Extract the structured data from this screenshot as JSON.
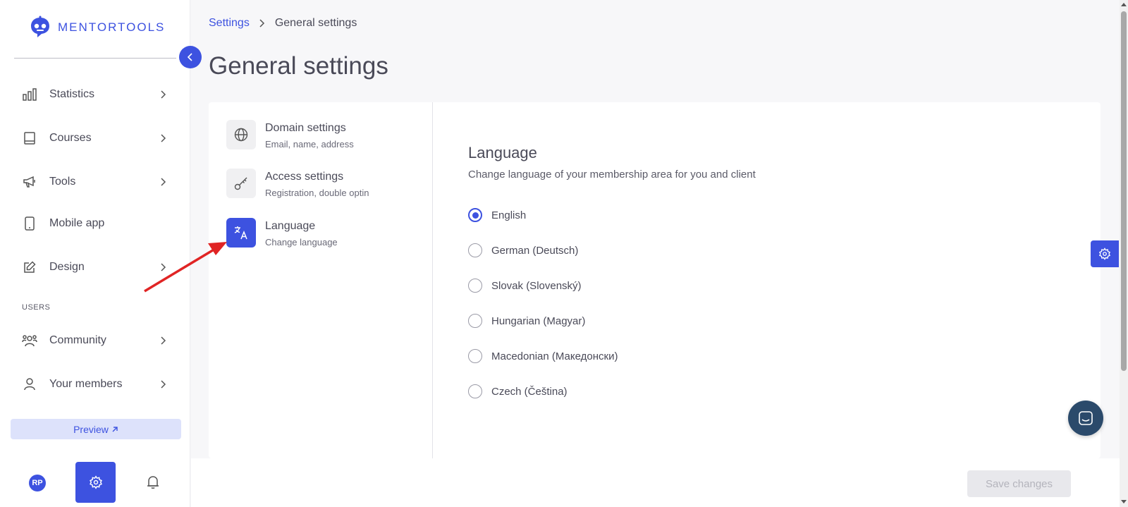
{
  "brand": {
    "name": "MENTORTOOLS",
    "accent": "#3d52e0"
  },
  "sidebar": {
    "items": [
      {
        "label": "Statistics",
        "icon": "bar-chart-icon",
        "has_chevron": true
      },
      {
        "label": "Courses",
        "icon": "book-icon",
        "has_chevron": true
      },
      {
        "label": "Tools",
        "icon": "megaphone-icon",
        "has_chevron": true
      },
      {
        "label": "Mobile app",
        "icon": "phone-icon",
        "has_chevron": false
      },
      {
        "label": "Design",
        "icon": "pencil-icon",
        "has_chevron": true
      },
      {
        "label": "Community",
        "icon": "users-icon",
        "has_chevron": true
      },
      {
        "label": "Your members",
        "icon": "user-icon",
        "has_chevron": true
      }
    ],
    "section_users": "USERS",
    "preview_label": "Preview",
    "avatar_initials": "RP"
  },
  "breadcrumb": {
    "parent": "Settings",
    "current": "General settings"
  },
  "page_title": "General settings",
  "settings_menu": [
    {
      "title": "Domain settings",
      "subtitle": "Email, name, address",
      "icon": "globe-icon",
      "active": false
    },
    {
      "title": "Access settings",
      "subtitle": "Registration, double optin",
      "icon": "key-icon",
      "active": false
    },
    {
      "title": "Language",
      "subtitle": "Change language",
      "icon": "translate-icon",
      "active": true
    }
  ],
  "language_section": {
    "title": "Language",
    "description": "Change language of your membership area for you and client",
    "options": [
      {
        "label": "English",
        "checked": true
      },
      {
        "label": "German (Deutsch)",
        "checked": false
      },
      {
        "label": "Slovak (Slovenský)",
        "checked": false
      },
      {
        "label": "Hungarian (Magyar)",
        "checked": false
      },
      {
        "label": "Macedonian (Македонски)",
        "checked": false
      },
      {
        "label": "Czech (Čeština)",
        "checked": false
      }
    ]
  },
  "save_label": "Save changes"
}
